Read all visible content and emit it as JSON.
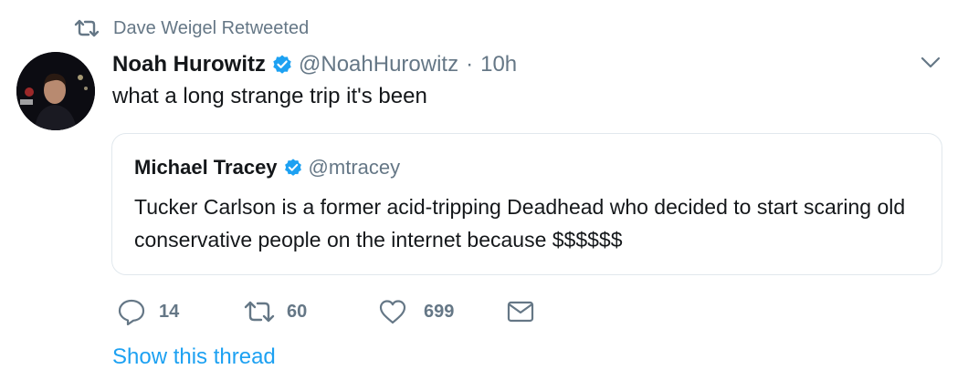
{
  "retweet_context": {
    "text": "Dave Weigel Retweeted",
    "icon": "retweet-icon"
  },
  "tweet": {
    "author_name": "Noah Hurowitz",
    "verified": true,
    "handle": "@NoahHurowitz",
    "separator": "·",
    "time": "10h",
    "text": "what a long strange trip it's been"
  },
  "quoted_tweet": {
    "author_name": "Michael Tracey",
    "verified": true,
    "handle": "@mtracey",
    "text": "Tucker Carlson is a former acid-tripping Deadhead who decided to start scaring old conservative people on the internet because $$$$$$"
  },
  "actions": {
    "reply_count": "14",
    "retweet_count": "60",
    "like_count": "699"
  },
  "show_thread_label": "Show this thread",
  "colors": {
    "accent": "#1da1f2",
    "secondary_text": "#657786",
    "border": "#e1e8ed"
  }
}
